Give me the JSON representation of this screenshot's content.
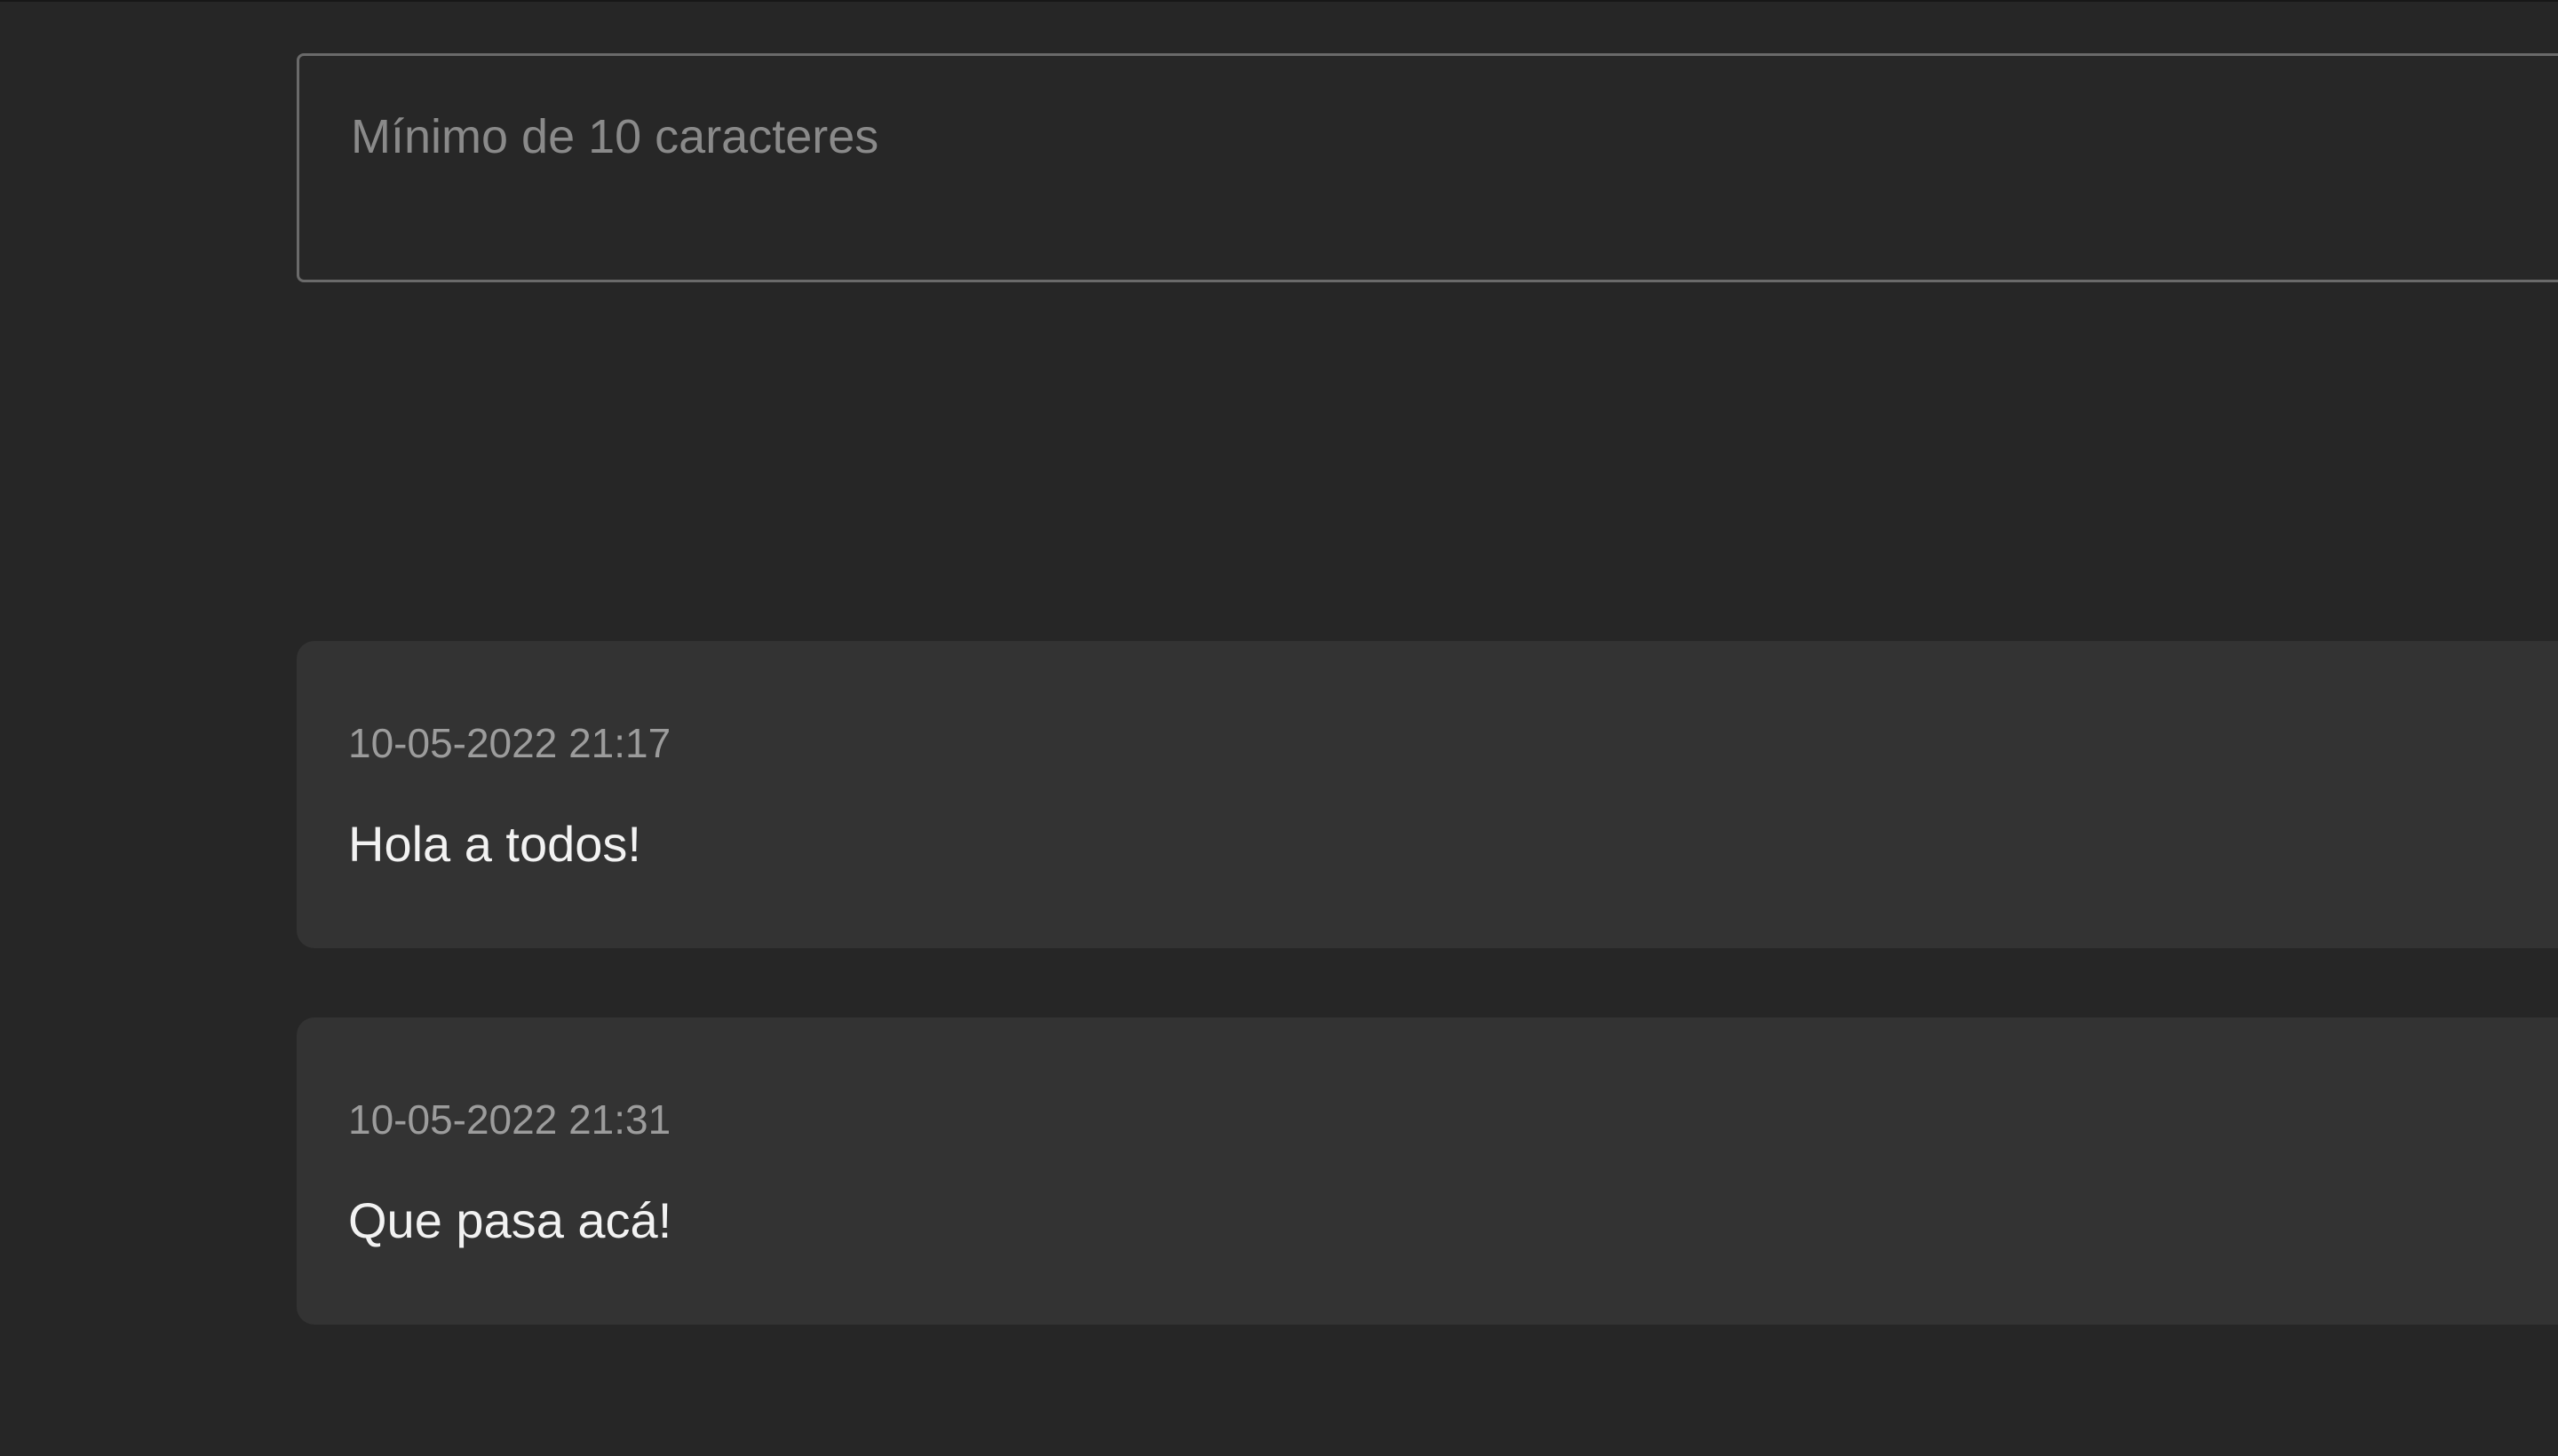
{
  "comment_form": {
    "placeholder": "Mínimo de 10 caracteres",
    "value": ""
  },
  "comments": [
    {
      "date": "10-05-2022 21:17",
      "text": "Hola a todos!"
    },
    {
      "date": "10-05-2022 21:31",
      "text": "Que pasa acá!"
    }
  ],
  "colors": {
    "background": "#262626",
    "card_background": "#333333",
    "input_border": "#6a6a6a",
    "date_text": "#9c9c9c",
    "comment_text": "#f2f2f2"
  }
}
